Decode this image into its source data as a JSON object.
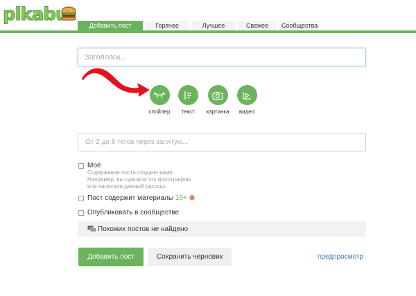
{
  "header": {
    "logo_text": "pikabu",
    "tabs": [
      {
        "label": "Добавить пост"
      },
      {
        "label": "Горячее"
      },
      {
        "label": "Лучшее"
      },
      {
        "label": "Свежее"
      },
      {
        "label": "Сообщества"
      }
    ],
    "accent_color": "#6cb35e"
  },
  "form": {
    "title_placeholder": "Заголовок...",
    "title_value": "",
    "content_types": [
      {
        "label": "спойлер",
        "icon": "spoiler-icon"
      },
      {
        "label": "текст",
        "icon": "text-icon"
      },
      {
        "label": "картинка",
        "icon": "camera-icon"
      },
      {
        "label": "видео",
        "icon": "video-icon"
      }
    ],
    "tags_placeholder": "От 2 до 8 тегов через запятую...",
    "tags_value": "",
    "own_content": {
      "label": "Моё",
      "hint_lines": [
        "Содержание поста создано вами.",
        "Например, вы сделали эту фотографию",
        "или написали данный рассказ."
      ]
    },
    "adult": {
      "label": "Пост содержит материалы",
      "badge": "16+"
    },
    "community": {
      "label": "Опубликовать в сообществе"
    },
    "similar_posts": "Похожих постов не найдено",
    "add_button": "Добавить пост",
    "draft_button": "Сохранить черновик",
    "preview_link": "предпросмотр"
  }
}
